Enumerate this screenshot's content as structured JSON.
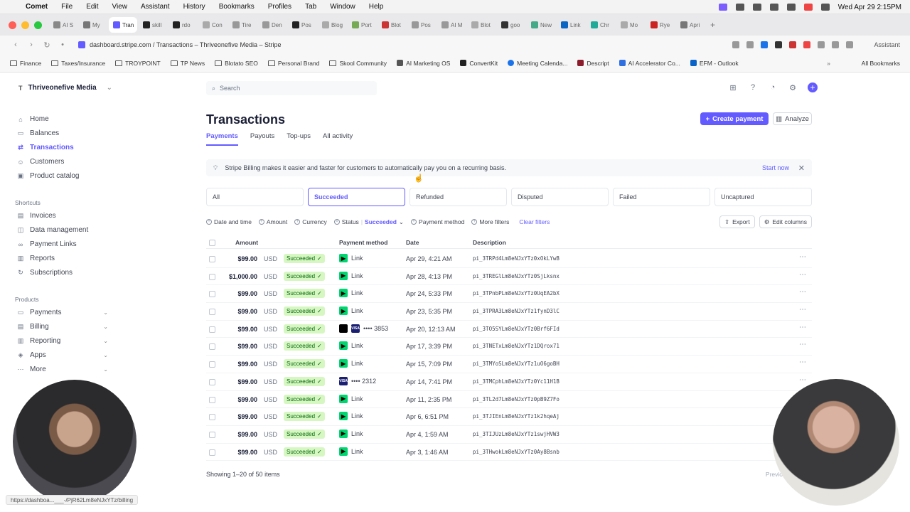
{
  "menubar": {
    "app": "Comet",
    "items": [
      "File",
      "Edit",
      "View",
      "Assistant",
      "History",
      "Bookmarks",
      "Profiles",
      "Tab",
      "Window",
      "Help"
    ],
    "datetime": "Wed Apr 29  2:15PM"
  },
  "tabs": [
    {
      "label": "AI S"
    },
    {
      "label": "My"
    },
    {
      "label": "Tran"
    },
    {
      "label": "skill"
    },
    {
      "label": "rdo"
    },
    {
      "label": "Con"
    },
    {
      "label": "Tire"
    },
    {
      "label": "Den"
    },
    {
      "label": "Pos"
    },
    {
      "label": "Blog"
    },
    {
      "label": "Port"
    },
    {
      "label": "Blot"
    },
    {
      "label": "Pos"
    },
    {
      "label": "AI M"
    },
    {
      "label": "Blot"
    },
    {
      "label": "goo"
    },
    {
      "label": "New"
    },
    {
      "label": "Link"
    },
    {
      "label": "Chr"
    },
    {
      "label": "Mo"
    },
    {
      "label": "Rye"
    },
    {
      "label": "Apri"
    }
  ],
  "address": {
    "url": "dashboard.stripe.com / Transactions – Thriveonefive Media – Stripe",
    "assistant": "Assistant"
  },
  "bookmarks": [
    "Finance",
    "Taxes/Insurance",
    "TROYPOINT",
    "TP News",
    "Blotato SEO",
    "Personal Brand",
    "Skool Community",
    "AI Marketing OS",
    "ConvertKit",
    "Meeting Calenda...",
    "Descript",
    "AI Accelerator Co...",
    "EFM - Outlook"
  ],
  "all_bookmarks": "All Bookmarks",
  "sidebar": {
    "account_initial": "T",
    "account": "Thriveonefive Media",
    "main_items": [
      "Home",
      "Balances",
      "Transactions",
      "Customers",
      "Product catalog"
    ],
    "shortcuts_label": "Shortcuts",
    "shortcuts": [
      "Invoices",
      "Data management",
      "Payment Links",
      "Reports",
      "Subscriptions"
    ],
    "products_label": "Products",
    "products": [
      "Payments",
      "Billing",
      "Reporting",
      "Apps",
      "More"
    ]
  },
  "search": {
    "placeholder": "Search"
  },
  "page": {
    "title": "Transactions",
    "create_payment": "Create payment",
    "analyze": "Analyze",
    "subtabs": [
      "Payments",
      "Payouts",
      "Top-ups",
      "All activity"
    ]
  },
  "banner": {
    "text": "Stripe Billing makes it easier and faster for customers to automatically pay you on a recurring basis.",
    "action": "Start now"
  },
  "status_filters": [
    "All",
    "Succeeded",
    "Refunded",
    "Disputed",
    "Failed",
    "Uncaptured"
  ],
  "filter_bar": {
    "date": "Date and time",
    "amount": "Amount",
    "currency": "Currency",
    "status_label": "Status",
    "status_value": "Succeeded",
    "payment_method": "Payment method",
    "more": "More filters",
    "clear": "Clear filters",
    "export": "Export",
    "edit_columns": "Edit columns"
  },
  "table": {
    "headers": {
      "amount": "Amount",
      "payment_method": "Payment method",
      "date": "Date",
      "description": "Description"
    },
    "rows": [
      {
        "amount": "$99.00",
        "currency": "USD",
        "status": "Succeeded",
        "pm_type": "link",
        "pm": "Link",
        "date": "Apr 29, 4:21 AM",
        "desc": "pi_3TRPd4Lm8eNJxYTz0xOkLYwB"
      },
      {
        "amount": "$1,000.00",
        "currency": "USD",
        "status": "Succeeded",
        "pm_type": "link",
        "pm": "Link",
        "date": "Apr 28, 4:13 PM",
        "desc": "pi_3TREGlLm8eNJxYTz0SjLksnx"
      },
      {
        "amount": "$99.00",
        "currency": "USD",
        "status": "Succeeded",
        "pm_type": "link",
        "pm": "Link",
        "date": "Apr 24, 5:33 PM",
        "desc": "pi_3TPnbPLm8eNJxYTz0UqEA2bX"
      },
      {
        "amount": "$99.00",
        "currency": "USD",
        "status": "Succeeded",
        "pm_type": "link",
        "pm": "Link",
        "date": "Apr 23, 5:35 PM",
        "desc": "pi_3TPRA3Lm8eNJxYTz1fynD3lC"
      },
      {
        "amount": "$99.00",
        "currency": "USD",
        "status": "Succeeded",
        "pm_type": "apple-visa",
        "pm": "•••• 3853",
        "date": "Apr 20, 12:13 AM",
        "desc": "pi_3TO5SYLm8eNJxYTz0Brf6FId"
      },
      {
        "amount": "$99.00",
        "currency": "USD",
        "status": "Succeeded",
        "pm_type": "link",
        "pm": "Link",
        "date": "Apr 17, 3:39 PM",
        "desc": "pi_3TNETxLm8eNJxYTz1DQrox71"
      },
      {
        "amount": "$99.00",
        "currency": "USD",
        "status": "Succeeded",
        "pm_type": "link",
        "pm": "Link",
        "date": "Apr 15, 7:09 PM",
        "desc": "pi_3TMYoSLm8eNJxYTz1uO6goBH"
      },
      {
        "amount": "$99.00",
        "currency": "USD",
        "status": "Succeeded",
        "pm_type": "visa",
        "pm": "•••• 2312",
        "date": "Apr 14, 7:41 PM",
        "desc": "pi_3TMCphLm8eNJxYTz0Yc11H1B"
      },
      {
        "amount": "$99.00",
        "currency": "USD",
        "status": "Succeeded",
        "pm_type": "link",
        "pm": "Link",
        "date": "Apr 11, 2:35 PM",
        "desc": "pi_3TL2d7Lm8eNJxYTz0pB9Z7Fo"
      },
      {
        "amount": "$99.00",
        "currency": "USD",
        "status": "Succeeded",
        "pm_type": "link",
        "pm": "Link",
        "date": "Apr 6, 6:51 PM",
        "desc": "pi_3TJIEnLm8eNJxYTz1k2hqeAj"
      },
      {
        "amount": "$99.00",
        "currency": "USD",
        "status": "Succeeded",
        "pm_type": "link",
        "pm": "Link",
        "date": "Apr 4, 1:59 AM",
        "desc": "pi_3TIJUzLm8eNJxYTz1swjHVW3"
      },
      {
        "amount": "$99.00",
        "currency": "USD",
        "status": "Succeeded",
        "pm_type": "link",
        "pm": "Link",
        "date": "Apr 3, 1:46 AM",
        "desc": "pi_3THwokLm8eNJxYTz0Ay8Bsnb"
      }
    ],
    "showing": "Showing 1–20 of 50 items",
    "previous": "Previous"
  },
  "status_url": "https://dashboa...___-/PjR62Lm8eNJxYTz/billing",
  "colors": {
    "accent": "#635bff",
    "success_bg": "#d7f7c2",
    "success_fg": "#05690d",
    "link_green": "#00d66f"
  }
}
